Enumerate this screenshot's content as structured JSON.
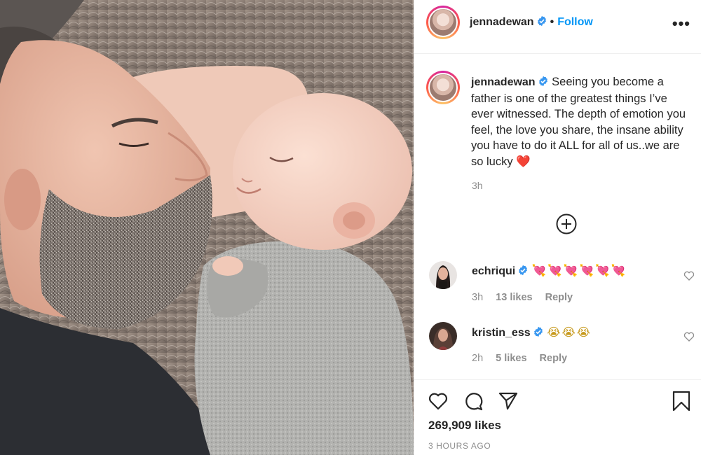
{
  "post": {
    "author": "jennadewan",
    "follow_label": "Follow",
    "dot": "•",
    "more_label": "•••",
    "caption_user": "jennadewan",
    "caption_text": "Seeing you become a father is one of the greatest things I’ve ever witnessed. The depth of emotion you feel, the love you share, the insane ability you have to do it ALL for all of us..we are so lucky",
    "caption_emoji": "❤️",
    "caption_time": "3h",
    "likes": "269,909 likes",
    "posted": "3 HOURS AGO"
  },
  "comments": [
    {
      "user": "echriqui",
      "emoji": "💘💘💘💘💘💘",
      "time": "3h",
      "likes": "13 likes",
      "reply": "Reply"
    },
    {
      "user": "kristin_ess",
      "emoji": "😭😭😭",
      "time": "2h",
      "likes": "5 likes",
      "reply": "Reply"
    }
  ],
  "icons": {
    "verified": "verified-badge-icon",
    "load_more": "plus-circle-icon",
    "like": "heart-icon",
    "comment": "comment-bubble-icon",
    "share": "paper-plane-icon",
    "save": "bookmark-icon"
  },
  "colors": {
    "accent": "#0095f6",
    "text": "#262626",
    "muted": "#8e8e8e",
    "divider": "#efefef"
  }
}
